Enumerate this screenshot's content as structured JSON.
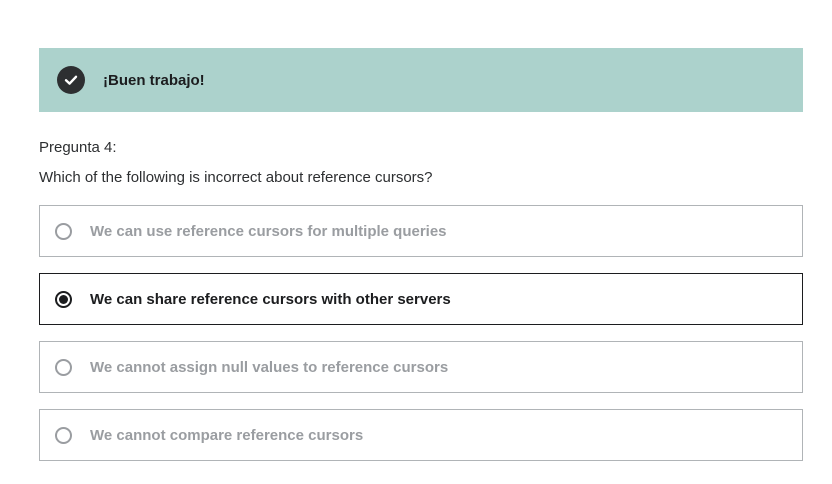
{
  "feedback": {
    "message": "¡Buen trabajo!",
    "icon": "check-circle-icon",
    "background_color": "#acd2cc"
  },
  "question": {
    "number_label": "Pregunta 4:",
    "text": "Which of the following is incorrect about reference cursors?"
  },
  "answers": [
    {
      "label": "We can use reference cursors for multiple queries",
      "selected": false
    },
    {
      "label": "We can share reference cursors with other servers",
      "selected": true
    },
    {
      "label": "We cannot assign null values to reference cursors",
      "selected": false
    },
    {
      "label": "We cannot compare reference cursors",
      "selected": false
    }
  ]
}
